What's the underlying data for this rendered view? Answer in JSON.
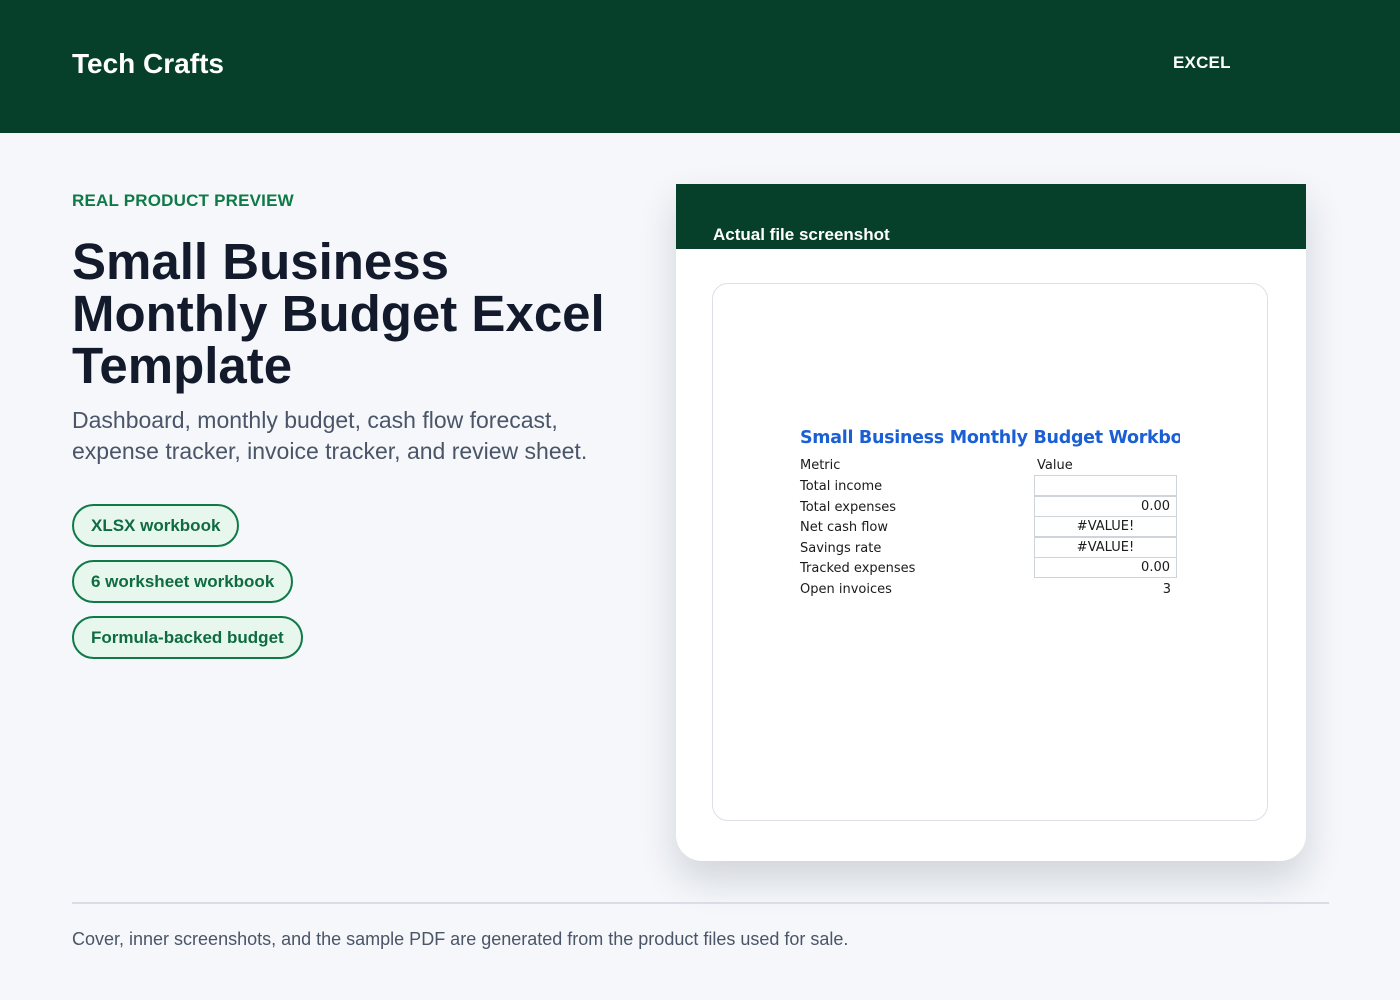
{
  "header": {
    "brand": "Tech Crafts",
    "nav_link": "EXCEL"
  },
  "hero": {
    "eyebrow": "REAL PRODUCT PREVIEW",
    "title": "Small Business Monthly Budget Excel Template",
    "subtitle": "Dashboard, monthly budget, cash flow forecast, expense tracker, invoice tracker, and review sheet.",
    "pills": [
      "XLSX workbook",
      "6 worksheet workbook",
      "Formula-backed budget"
    ]
  },
  "preview": {
    "label": "Actual file screenshot",
    "sheet": {
      "title": "Small Business Monthly Budget Workbook",
      "headers": {
        "metric": "Metric",
        "value": "Value"
      },
      "rows": [
        {
          "label": "Total income",
          "value": ""
        },
        {
          "label": "Total expenses",
          "value": "0.00"
        },
        {
          "label": "Net cash flow",
          "value": "#VALUE!"
        },
        {
          "label": "Savings rate",
          "value": "#VALUE!"
        },
        {
          "label": "Tracked expenses",
          "value": "0.00"
        },
        {
          "label": "Open invoices",
          "value": "3"
        }
      ]
    }
  },
  "footer": {
    "note": "Cover, inner screenshots, and the sample PDF are generated from the product files used for sale."
  },
  "colors": {
    "header_bg": "#06402b",
    "accent_green": "#0f7a47",
    "sheet_title_blue": "#1a5fd6",
    "page_bg": "#f5f7fa"
  }
}
